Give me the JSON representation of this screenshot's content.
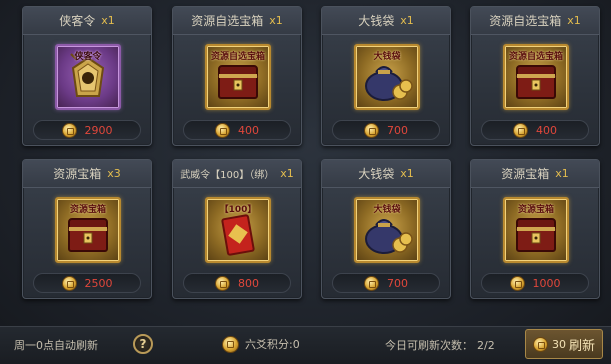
{
  "cards": [
    {
      "title": "侠客令",
      "qty": "x1",
      "item_label": "侠客令",
      "price": "2900",
      "kind": "token"
    },
    {
      "title": "资源自选宝箱",
      "qty": "x1",
      "item_label": "资源自选宝箱",
      "price": "400",
      "kind": "chest"
    },
    {
      "title": "大钱袋",
      "qty": "x1",
      "item_label": "大钱袋",
      "price": "700",
      "kind": "moneybag"
    },
    {
      "title": "资源自选宝箱",
      "qty": "x1",
      "item_label": "资源自选宝箱",
      "price": "400",
      "kind": "chest"
    },
    {
      "title": "资源宝箱",
      "qty": "x3",
      "item_label": "资源宝箱",
      "price": "2500",
      "kind": "chest"
    },
    {
      "title": "武威令【100】（绑）",
      "qty": "x1",
      "item_label": "【100】",
      "price": "800",
      "kind": "redenvelope"
    },
    {
      "title": "大钱袋",
      "qty": "x1",
      "item_label": "大钱袋",
      "price": "700",
      "kind": "moneybag"
    },
    {
      "title": "资源宝箱",
      "qty": "x1",
      "item_label": "资源宝箱",
      "price": "1000",
      "kind": "chest"
    }
  ],
  "footer": {
    "auto_refresh": "周一0点自动刷新",
    "help": "?",
    "points": "六爻积分:0",
    "refresh_count_label": "今日可刷新次数：",
    "refresh_count": "2/2",
    "refresh_cost": "30",
    "refresh_label": "刷新"
  },
  "colors": {
    "price": "#e0473b",
    "qty": "#e3bd4f",
    "gold_border": "#b8892f",
    "purple_border": "#8d5aa8"
  }
}
